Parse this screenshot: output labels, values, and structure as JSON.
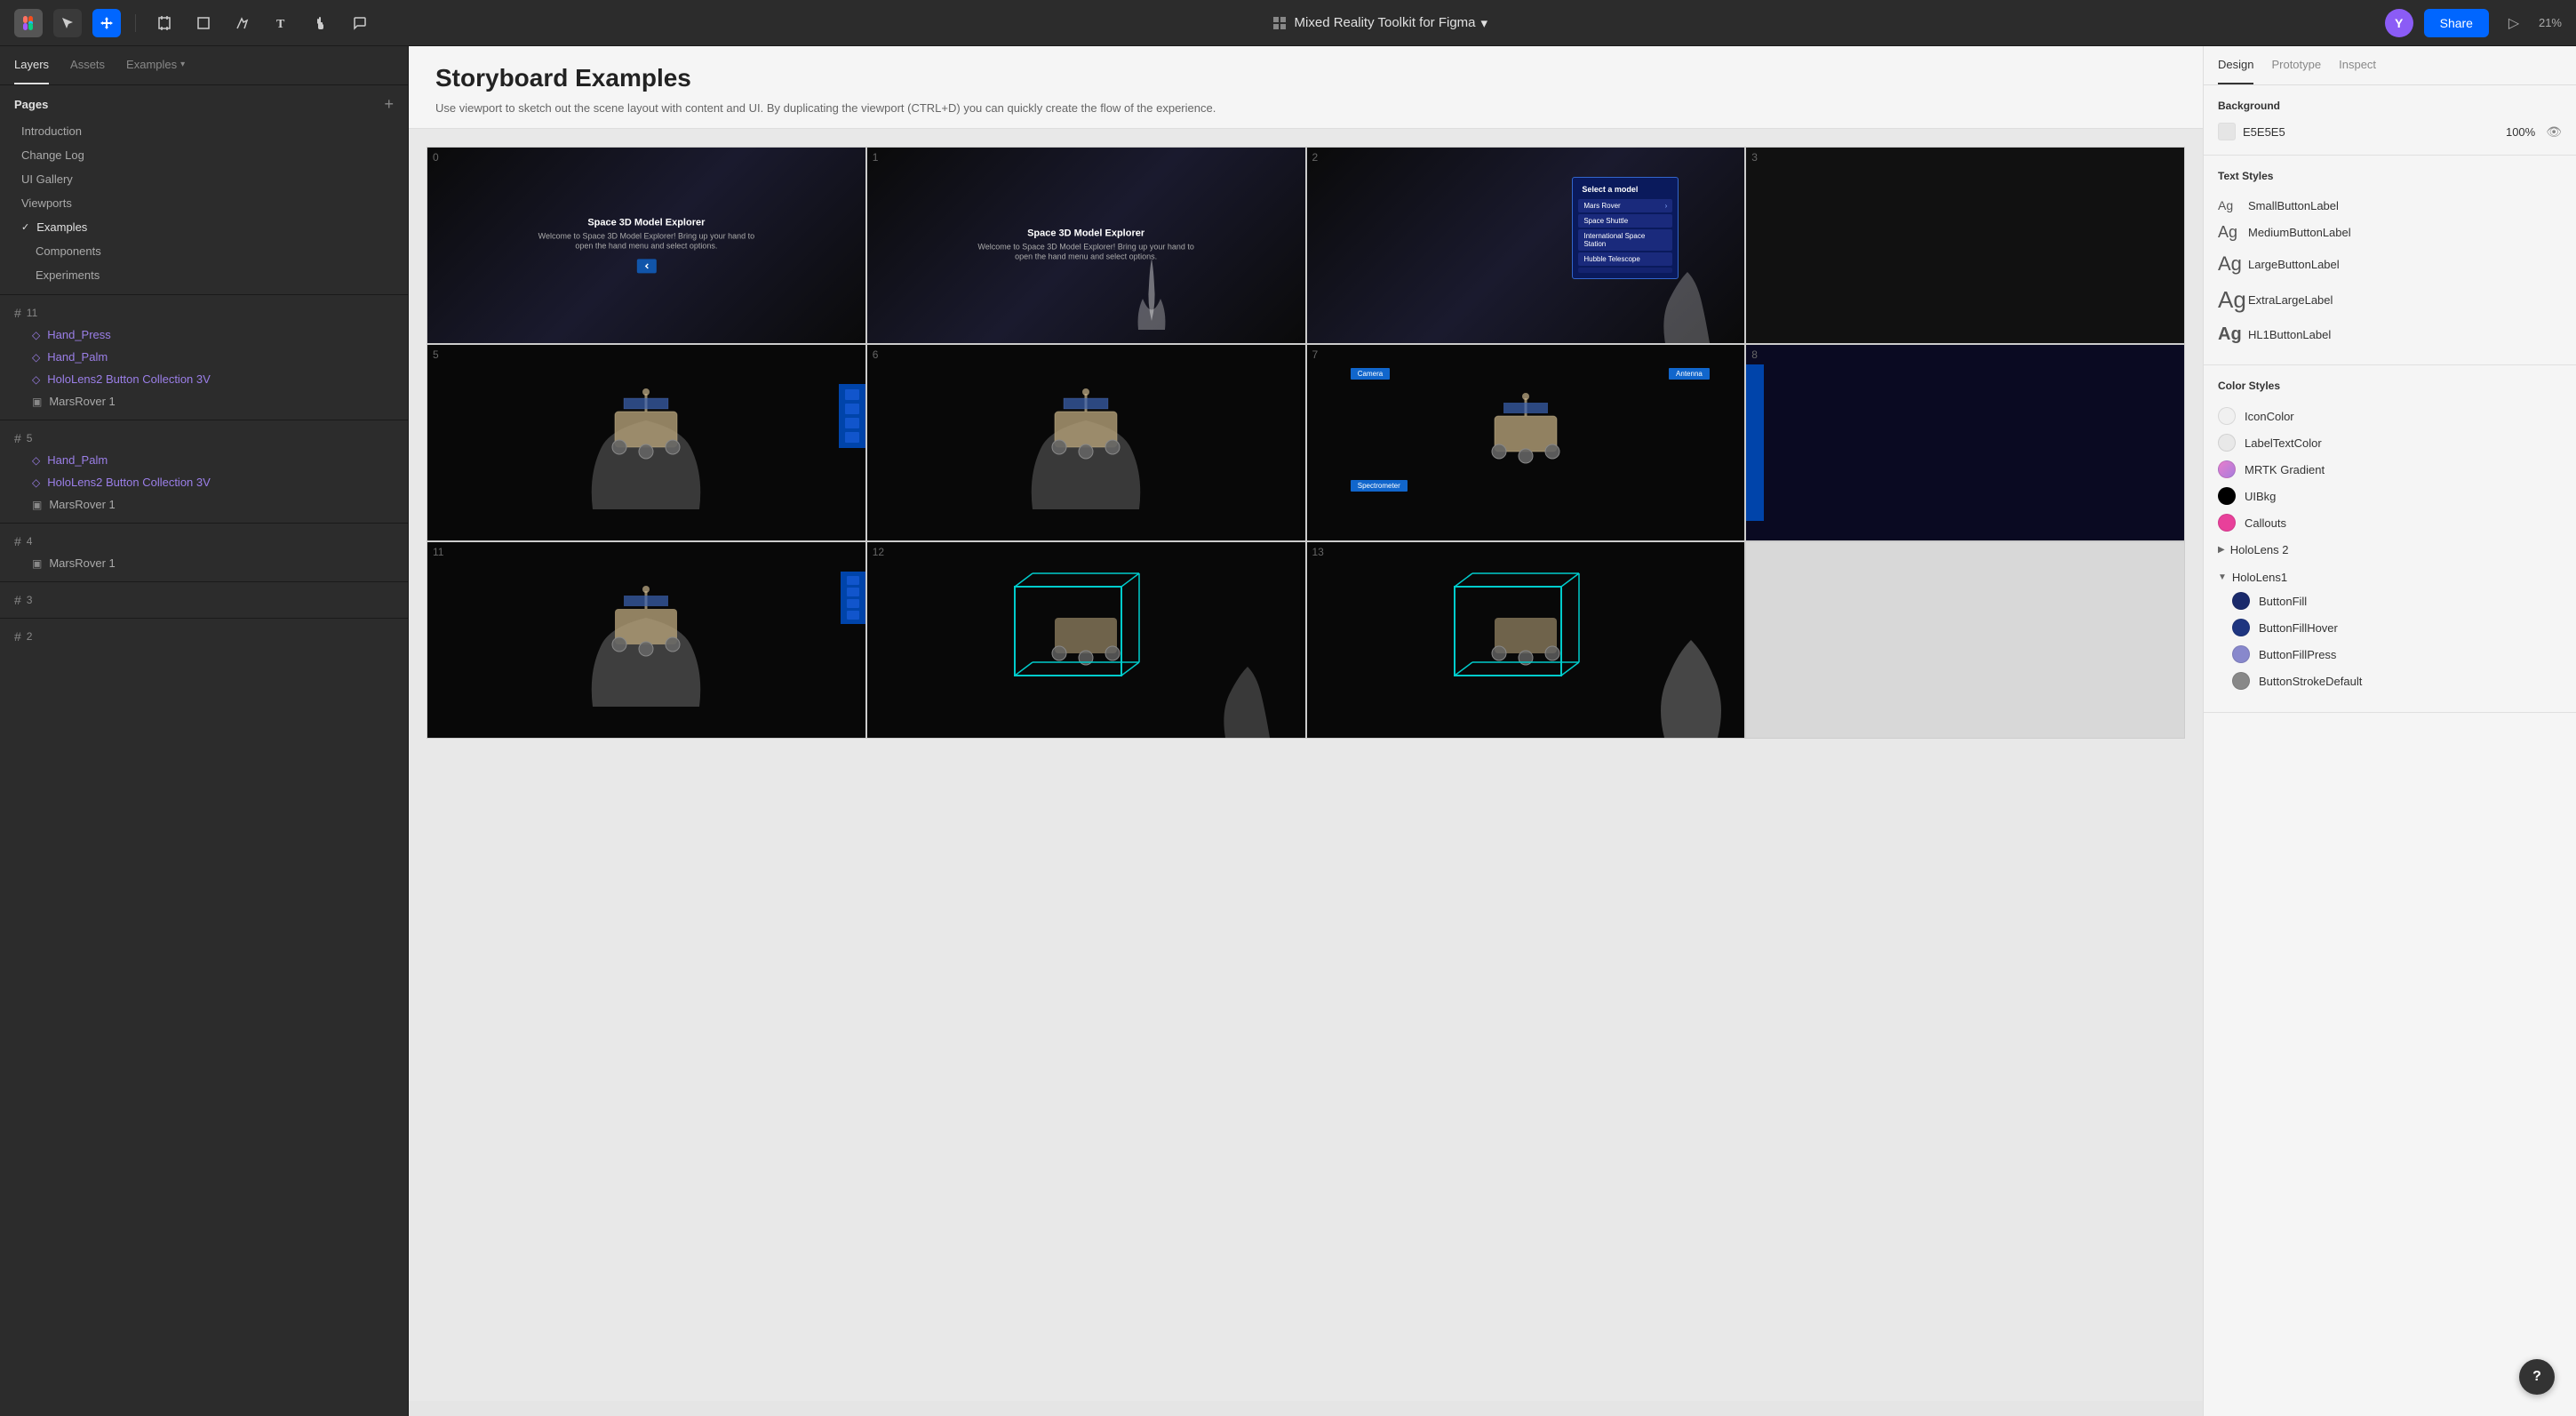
{
  "toolbar": {
    "project_name": "Mixed Reality Toolkit for Figma",
    "zoom_level": "21%",
    "share_label": "Share",
    "avatar_initial": "Y"
  },
  "left_panel": {
    "tabs": [
      {
        "label": "Layers",
        "active": true
      },
      {
        "label": "Assets",
        "active": false
      },
      {
        "label": "Examples",
        "active": false,
        "has_caret": true
      }
    ],
    "pages": {
      "title": "Pages",
      "items": [
        {
          "label": "Introduction",
          "active": false
        },
        {
          "label": "Change Log",
          "active": false
        },
        {
          "label": "UI Gallery",
          "active": false
        },
        {
          "label": "Viewports",
          "active": false
        },
        {
          "label": "Examples",
          "active": true,
          "checked": true
        },
        {
          "label": "Components",
          "active": false
        },
        {
          "label": "Experiments",
          "active": false
        }
      ]
    },
    "layers": [
      {
        "id": "11",
        "items": [
          {
            "type": "component",
            "label": "Hand_Press"
          },
          {
            "type": "component",
            "label": "Hand_Palm"
          },
          {
            "type": "component",
            "label": "HoloLens2 Button Collection 3V"
          },
          {
            "type": "image",
            "label": "MarsRover 1"
          }
        ]
      },
      {
        "id": "5",
        "items": [
          {
            "type": "component",
            "label": "Hand_Palm"
          },
          {
            "type": "component",
            "label": "HoloLens2 Button Collection 3V"
          },
          {
            "type": "image",
            "label": "MarsRover 1"
          }
        ]
      },
      {
        "id": "4",
        "items": [
          {
            "type": "image",
            "label": "MarsRover 1"
          }
        ]
      },
      {
        "id": "3",
        "items": []
      },
      {
        "id": "2",
        "items": []
      }
    ]
  },
  "canvas": {
    "title": "Storyboard Examples",
    "subtitle": "Use viewport to sketch out the scene layout with content and UI. By duplicating the viewport (CTRL+D) you can quickly create the flow of the experience.",
    "cells": [
      {
        "number": "0",
        "type": "intro_scene",
        "has_text": true,
        "has_btn": true,
        "title": "Space 3D Model Explorer",
        "desc": "Welcome to Space 3D Model Explorer! Bring up your hand to open the hand menu and select options."
      },
      {
        "number": "1",
        "type": "finger_scene",
        "has_text": true,
        "has_finger": true,
        "title": "Space 3D Model Explorer",
        "desc": "Welcome to Space 3D Model Explorer! Bring up your hand to open the hand menu and select options."
      },
      {
        "number": "2",
        "type": "menu_scene",
        "has_menu": true
      },
      {
        "number": "3",
        "type": "partial",
        "clipped": true
      },
      {
        "number": "5",
        "type": "rover_hand"
      },
      {
        "number": "6",
        "type": "rover_hand2"
      },
      {
        "number": "7",
        "type": "rover_labels",
        "labels": [
          "Camera",
          "Antenna",
          "Spectrometer"
        ]
      },
      {
        "number": "8",
        "type": "partial_blue",
        "clipped": true
      },
      {
        "number": "11",
        "type": "rover_palm"
      },
      {
        "number": "12",
        "type": "rover_cyan_box"
      },
      {
        "number": "13",
        "type": "rover_cyan_box2"
      }
    ]
  },
  "right_panel": {
    "tabs": [
      {
        "label": "Design",
        "active": true
      },
      {
        "label": "Prototype",
        "active": false
      },
      {
        "label": "Inspect",
        "active": false
      }
    ],
    "background": {
      "title": "Background",
      "color": "E5E5E5",
      "opacity": "100%",
      "swatch_color": "#e5e5e5"
    },
    "text_styles": {
      "title": "Text Styles",
      "items": [
        {
          "size_class": "small",
          "label": "SmallButtonLabel"
        },
        {
          "size_class": "medium",
          "label": "MediumButtonLabel"
        },
        {
          "size_class": "large",
          "label": "LargeButtonLabel"
        },
        {
          "size_class": "xlarge",
          "label": "ExtraLargeLabel"
        },
        {
          "size_class": "hl1",
          "label": "HL1ButtonLabel"
        }
      ]
    },
    "color_styles": {
      "title": "Color Styles",
      "top_items": [
        {
          "label": "IconColor",
          "color": "#f0f0f0",
          "type": "light_circle"
        },
        {
          "label": "LabelTextColor",
          "color": "#e8e8e8",
          "type": "light_circle"
        },
        {
          "label": "MRTK Gradient",
          "color": "#e87dcc",
          "type": "pink_circle"
        },
        {
          "label": "UIBkg",
          "color": "#000000",
          "type": "black_circle"
        },
        {
          "label": "Callouts",
          "color": "#e8409a",
          "type": "magenta_circle"
        }
      ],
      "groups": [
        {
          "label": "HoloLens 2",
          "collapsed": true,
          "items": []
        },
        {
          "label": "HoloLens1",
          "collapsed": false,
          "items": [
            {
              "label": "ButtonFill",
              "color": "#1a2a6b"
            },
            {
              "label": "ButtonFillHover",
              "color": "#1e3580"
            },
            {
              "label": "ButtonFillPress",
              "color": "#8888cc"
            },
            {
              "label": "ButtonStrokeDefault",
              "color": "#888888"
            }
          ]
        }
      ]
    }
  }
}
